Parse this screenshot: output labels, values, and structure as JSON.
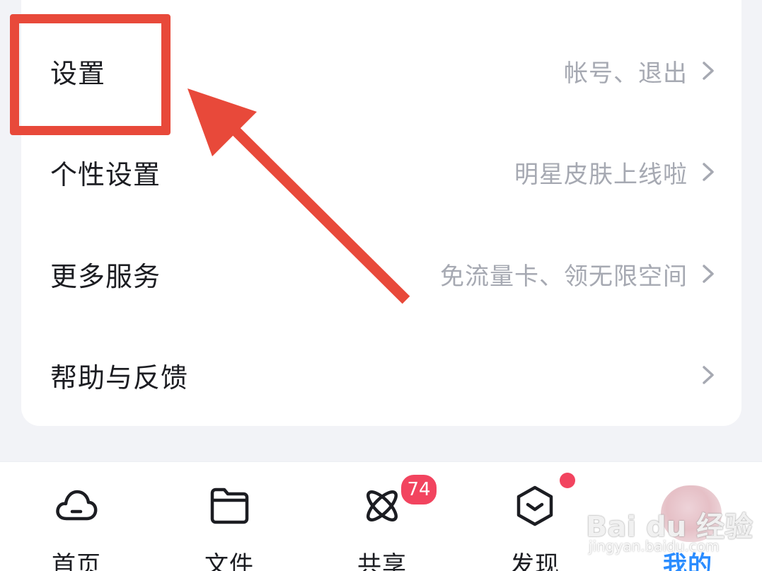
{
  "menu": {
    "items": [
      {
        "label": "设置",
        "hint": "帐号、退出"
      },
      {
        "label": "个性设置",
        "hint": "明星皮肤上线啦"
      },
      {
        "label": "更多服务",
        "hint": "免流量卡、领无限空间"
      },
      {
        "label": "帮助与反馈",
        "hint": ""
      }
    ]
  },
  "annotation": {
    "color": "#e8493a"
  },
  "tabbar": {
    "tabs": [
      {
        "label": "首页",
        "icon": "cloud-icon"
      },
      {
        "label": "文件",
        "icon": "folder-icon"
      },
      {
        "label": "共享",
        "icon": "atom-icon",
        "badge": "74"
      },
      {
        "label": "发现",
        "icon": "cube-icon",
        "dot": true
      },
      {
        "label": "我的",
        "icon": "avatar",
        "active": true
      }
    ],
    "active_color": "#2a8cff",
    "badge_color": "#f2445f"
  },
  "watermark": {
    "main": "Bai du 经验",
    "sub": "jingyan.baidu.com"
  }
}
